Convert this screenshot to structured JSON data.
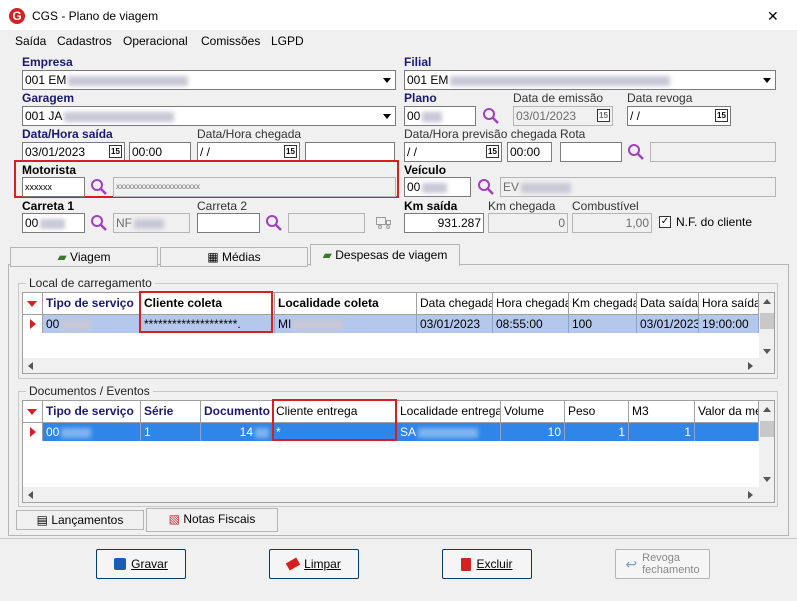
{
  "window": {
    "title": "CGS - Plano de viagem",
    "close": "✕"
  },
  "menu": [
    "Saída",
    "Cadastros",
    "Operacional",
    "Comissões",
    "LGPD"
  ],
  "form": {
    "empresa": {
      "label": "Empresa",
      "value": "001 EM"
    },
    "filial": {
      "label": "Filial",
      "value": "001 EM"
    },
    "garagem": {
      "label": "Garagem",
      "value": "001 JA"
    },
    "plano": {
      "label": "Plano",
      "value": "00"
    },
    "data_emissao": {
      "label": "Data de emissão",
      "value": "03/01/2023"
    },
    "data_revoga": {
      "label": "Data revoga",
      "value": " /  /"
    },
    "data_hora_saida": {
      "label": "Data/Hora saída",
      "date": "03/01/2023",
      "time": "00:00"
    },
    "data_hora_chegada": {
      "label": "Data/Hora chegada",
      "date": " /  /",
      "time": ""
    },
    "data_hora_prev": {
      "label": "Data/Hora previsão chegada",
      "date": " /  /",
      "time": "00:00"
    },
    "rota": {
      "label": "Rota",
      "value": ""
    },
    "motorista": {
      "label": "Motorista",
      "code": "xxxxxx",
      "name": "xxxxxxxxxxxxxxxxxxxxx"
    },
    "veiculo": {
      "label": "Veículo",
      "code": "00",
      "desc": "EV"
    },
    "carreta1": {
      "label": "Carreta 1",
      "code": "00",
      "desc": "NF"
    },
    "carreta2": {
      "label": "Carreta 2",
      "code": "",
      "desc": ""
    },
    "km_saida": {
      "label": "Km saída",
      "value": "931.287"
    },
    "km_chegada": {
      "label": "Km chegada",
      "value": "0"
    },
    "combustivel": {
      "label": "Combustível",
      "value": "1,00"
    },
    "nf_cliente": {
      "label": "N.F. do cliente",
      "checked": true
    }
  },
  "tabs": [
    "Viagem",
    "Médias",
    "Despesas de viagem"
  ],
  "active_tab": 2,
  "carregamento": {
    "title": "Local de carregamento",
    "columns": [
      "Tipo de serviço",
      "Cliente coleta",
      "Localidade coleta",
      "Data chegada",
      "Hora chegada",
      "Km chegada",
      "Data saída",
      "Hora saída"
    ],
    "row": [
      "00",
      "********************.",
      "MI",
      "03/01/2023",
      "08:55:00",
      "100",
      "03/01/2023",
      "19:00:00"
    ]
  },
  "documentos": {
    "title": "Documentos / Eventos",
    "columns": [
      "Tipo de serviço",
      "Série",
      "Documento",
      "Cliente entrega",
      "Localidade entrega",
      "Volume",
      "Peso",
      "M3",
      "Valor da mer"
    ],
    "row": [
      "00",
      "1",
      "14",
      "*",
      "SA",
      "10",
      "1",
      "1",
      ""
    ]
  },
  "bottom_tabs": [
    "Lançamentos",
    "Notas Fiscais"
  ],
  "buttons": {
    "gravar": "Gravar",
    "limpar": "Limpar",
    "excluir": "Excluir",
    "revoga": "Revoga\nfechamento"
  },
  "colors": {
    "selected_row": "#b4c8ec",
    "selected_row2": "#2f86e8",
    "highlight": "#d42020",
    "label_blue": "#1a1a6e"
  }
}
